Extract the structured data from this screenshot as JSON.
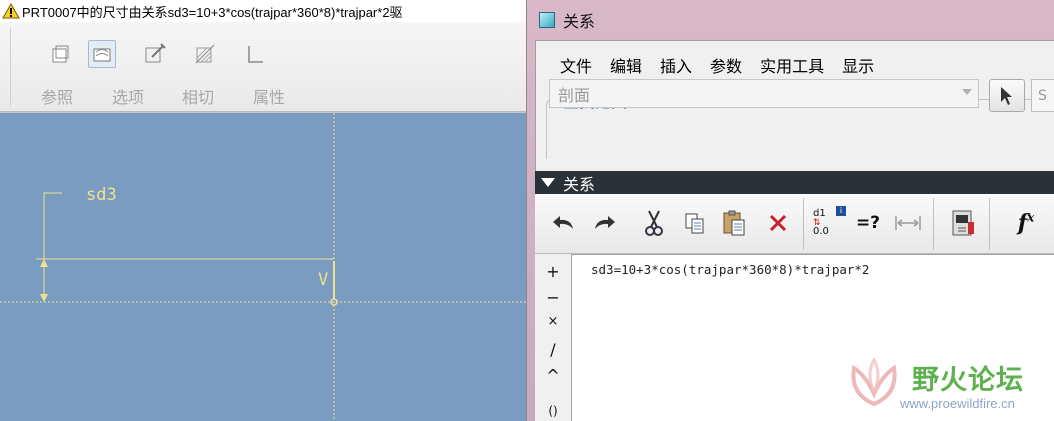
{
  "left_window": {
    "title": "PRT0007中的尺寸由关系sd3=10+3*cos(trajpar*360*8)*trajpar*2驱",
    "ribbon": {
      "labels": [
        "参照",
        "选项",
        "相切",
        "属性"
      ]
    },
    "sketch": {
      "dimension_label": "sd3",
      "vertex_label": "V"
    }
  },
  "dialog": {
    "title": "关系",
    "menu": [
      "文件",
      "编辑",
      "插入",
      "参数",
      "实用工具",
      "显示"
    ],
    "search": {
      "legend": "查找范围",
      "scope_value": "剖面",
      "selector_partial": "S"
    },
    "relations_section_label": "关系",
    "toolbar": {
      "dim_switch_top": "d1",
      "dim_switch_bottom": "0.0",
      "evaluate_label": "=?",
      "fx_label": "f"
    },
    "operators": [
      "+",
      "−",
      "×",
      "/",
      "^",
      "()"
    ],
    "relation_text": "sd3=10+3*cos(trajpar*360*8)*trajpar*2"
  },
  "watermark": {
    "name": "野火论坛",
    "url": "www.proewildfire.cn"
  },
  "colors": {
    "sketch_bg": "#7a9cc0",
    "sketch_line": "#f0e090",
    "legend_blue": "#3a6ea5",
    "section_header": "#2a3237"
  }
}
